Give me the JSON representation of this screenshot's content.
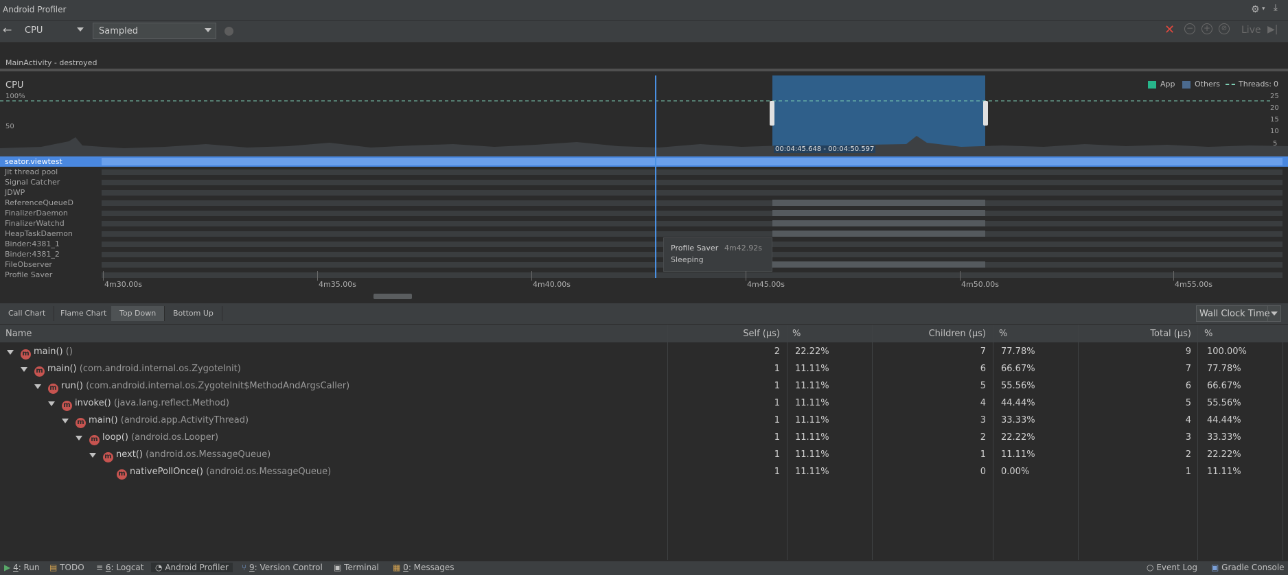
{
  "window": {
    "title": "Android Profiler"
  },
  "toolbar": {
    "monitor": "CPU",
    "config": "Sampled",
    "live_label": "Live",
    "back_icon": "arrow-left-icon",
    "record_icon": "record-dot-icon",
    "stop_icon": "close-x-icon",
    "zoom_out_icon": "zoom-out-icon",
    "zoom_in_icon": "zoom-in-icon",
    "reset_zoom_icon": "reset-zoom-icon",
    "jump_live_icon": "jump-to-live-icon",
    "settings_icon": "gear-icon",
    "minimize_icon": "minimize-icon"
  },
  "event": {
    "activity": "MainActivity - destroyed"
  },
  "cpu": {
    "label": "CPU",
    "y100": "100%",
    "y50": "50",
    "right_ticks": [
      "25",
      "20",
      "15",
      "10",
      "5"
    ],
    "legend": {
      "app": "App",
      "others": "Others",
      "threads": "Threads:",
      "threads_value": "0"
    },
    "selection_range": "00:04:45.648 - 00:04:50.597"
  },
  "threads": [
    "seator.viewtest",
    "Jit thread pool",
    "Signal Catcher",
    "JDWP",
    "ReferenceQueueD",
    "FinalizerDaemon",
    "FinalizerWatchd",
    "HeapTaskDaemon",
    "Binder:4381_1",
    "Binder:4381_2",
    "FileObserver",
    "Profile Saver"
  ],
  "tooltip": {
    "title": "Profile Saver",
    "time": "4m42.92s",
    "state": "Sleeping"
  },
  "axis": {
    "ticks": [
      "4m30.00s",
      "4m35.00s",
      "4m40.00s",
      "4m45.00s",
      "4m50.00s",
      "4m55.00s"
    ]
  },
  "tabs": [
    "Call Chart",
    "Flame Chart",
    "Top Down",
    "Bottom Up"
  ],
  "clock": "Wall Clock Time",
  "table": {
    "headers": {
      "name": "Name",
      "self": "Self (µs)",
      "pct1": "%",
      "children": "Children (µs)",
      "pct2": "%",
      "total": "Total (µs)",
      "pct3": "%"
    },
    "rows": [
      {
        "method": "main()",
        "pkg": "()",
        "self": "2",
        "self_pct": "22.22%",
        "children": "7",
        "children_pct": "77.78%",
        "total": "9",
        "total_pct": "100.00%"
      },
      {
        "method": "main()",
        "pkg": "(com.android.internal.os.ZygoteInit)",
        "self": "1",
        "self_pct": "11.11%",
        "children": "6",
        "children_pct": "66.67%",
        "total": "7",
        "total_pct": "77.78%"
      },
      {
        "method": "run()",
        "pkg": "(com.android.internal.os.ZygoteInit$MethodAndArgsCaller)",
        "self": "1",
        "self_pct": "11.11%",
        "children": "5",
        "children_pct": "55.56%",
        "total": "6",
        "total_pct": "66.67%"
      },
      {
        "method": "invoke()",
        "pkg": "(java.lang.reflect.Method)",
        "self": "1",
        "self_pct": "11.11%",
        "children": "4",
        "children_pct": "44.44%",
        "total": "5",
        "total_pct": "55.56%"
      },
      {
        "method": "main()",
        "pkg": "(android.app.ActivityThread)",
        "self": "1",
        "self_pct": "11.11%",
        "children": "3",
        "children_pct": "33.33%",
        "total": "4",
        "total_pct": "44.44%"
      },
      {
        "method": "loop()",
        "pkg": "(android.os.Looper)",
        "self": "1",
        "self_pct": "11.11%",
        "children": "2",
        "children_pct": "22.22%",
        "total": "3",
        "total_pct": "33.33%"
      },
      {
        "method": "next()",
        "pkg": "(android.os.MessageQueue)",
        "self": "1",
        "self_pct": "11.11%",
        "children": "1",
        "children_pct": "11.11%",
        "total": "2",
        "total_pct": "22.22%"
      },
      {
        "method": "nativePollOnce()",
        "pkg": "(android.os.MessageQueue)",
        "self": "1",
        "self_pct": "11.11%",
        "children": "0",
        "children_pct": "0.00%",
        "total": "1",
        "total_pct": "11.11%"
      }
    ]
  },
  "statusbar": {
    "run": {
      "key": "4",
      "label": ": Run"
    },
    "todo": "TODO",
    "logcat": {
      "key": "6",
      "label": ": Logcat"
    },
    "profiler": "Android Profiler",
    "vcs": {
      "key": "9",
      "label": ": Version Control"
    },
    "terminal": "Terminal",
    "messages": {
      "key": "0",
      "label": ": Messages"
    },
    "event_log": "Event Log",
    "gradle": "Gradle Console"
  },
  "colors": {
    "selection": "#2f5f8a",
    "app": "#27b68b",
    "others": "#4b6a8e",
    "thread_selected": "#4a88e0",
    "playhead": "#4a90e2"
  }
}
